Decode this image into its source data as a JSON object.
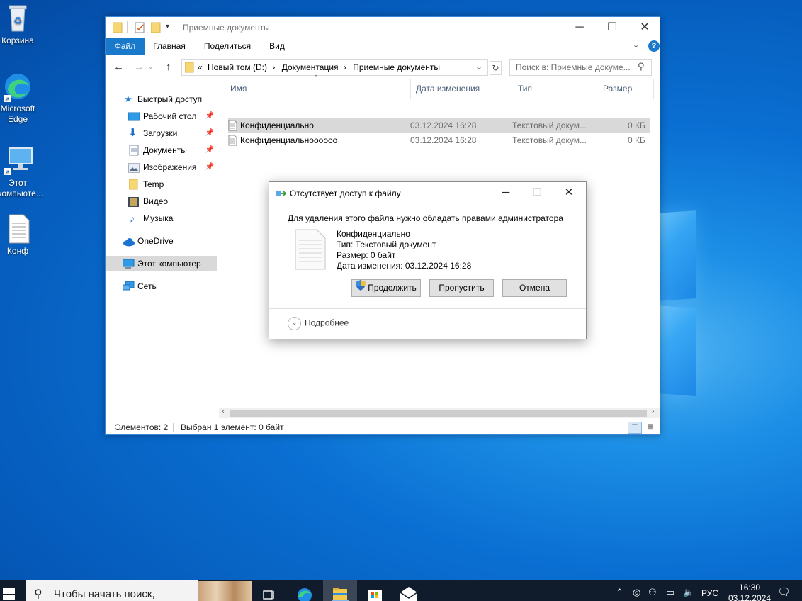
{
  "desktop": {
    "icons": [
      {
        "label": "Корзина",
        "icon": "recycle-bin-icon"
      },
      {
        "label": "Microsoft Edge",
        "icon": "edge-icon"
      },
      {
        "label": "Этот компьюте...",
        "icon": "this-pc-icon"
      },
      {
        "label": "Конф",
        "icon": "text-file-icon"
      }
    ]
  },
  "explorer": {
    "title": "Приемные документы",
    "ribbon_tabs": [
      "Файл",
      "Главная",
      "Поделиться",
      "Вид"
    ],
    "address": {
      "overflow": "«",
      "crumbs": [
        "Новый том (D:)",
        "Документация",
        "Приемные документы"
      ]
    },
    "search_placeholder": "Поиск в: Приемные докуме...",
    "nav": {
      "quick_access": "Быстрый доступ",
      "pinned": [
        {
          "label": "Рабочий стол",
          "icon": "desktop-icon",
          "pinned": true
        },
        {
          "label": "Загрузки",
          "icon": "downloads-icon",
          "pinned": true
        },
        {
          "label": "Документы",
          "icon": "documents-icon",
          "pinned": true
        },
        {
          "label": "Изображения",
          "icon": "pictures-icon",
          "pinned": true
        },
        {
          "label": "Temp",
          "icon": "folder-icon",
          "pinned": false
        },
        {
          "label": "Видео",
          "icon": "video-icon",
          "pinned": false
        },
        {
          "label": "Музыка",
          "icon": "music-icon",
          "pinned": false
        }
      ],
      "onedrive": "OneDrive",
      "this_pc": "Этот компьютер",
      "network": "Сеть"
    },
    "columns": [
      "Имя",
      "Дата изменения",
      "Тип",
      "Размер"
    ],
    "files": [
      {
        "name": "Конфиденциально",
        "date": "03.12.2024 16:28",
        "type": "Текстовый докум...",
        "size": "0 КБ",
        "selected": true
      },
      {
        "name": "Конфиденциальноооооо",
        "date": "03.12.2024 16:28",
        "type": "Текстовый докум...",
        "size": "0 КБ",
        "selected": false
      }
    ],
    "status": {
      "count": "Элементов: 2",
      "selection": "Выбран 1 элемент: 0 байт"
    }
  },
  "dialog": {
    "title": "Отсутствует доступ к файлу",
    "message": "Для удаления этого файла нужно обладать правами администратора",
    "file_name": "Конфиденциально",
    "file_type": "Тип: Текстовый документ",
    "file_size": "Размер: 0 байт",
    "file_date": "Дата изменения: 03.12.2024 16:28",
    "buttons": {
      "continue": "Продолжить",
      "skip": "Пропустить",
      "cancel": "Отмена"
    },
    "more": "Подробнее"
  },
  "taskbar": {
    "search_placeholder": "Чтобы начать поиск,",
    "lang": "РУС",
    "time": "16:30",
    "date": "03.12.2024"
  }
}
